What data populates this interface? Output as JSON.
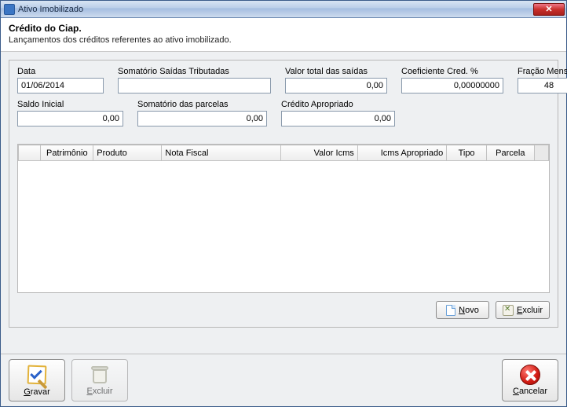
{
  "window": {
    "title": "Ativo Imobilizado"
  },
  "header": {
    "title": "Crédito do Ciap.",
    "subtitle": "Lançamentos dos créditos referentes ao ativo imobilizado."
  },
  "fields": {
    "data": {
      "label": "Data",
      "value": "01/06/2014"
    },
    "somatorio_saidas_trib": {
      "label": "Somatório Saídas Tributadas",
      "value": ""
    },
    "valor_total_saidas": {
      "label": "Valor total das saídas",
      "value": "0,00"
    },
    "coef_cred": {
      "label": "Coeficiente Cred. %",
      "value": "0,00000000"
    },
    "fracao_mensal": {
      "label": "Fração Mensal",
      "value": "48"
    },
    "saldo_inicial": {
      "label": "Saldo Inicial",
      "value": "0,00"
    },
    "somatorio_parcelas": {
      "label": "Somatório das parcelas",
      "value": "0,00"
    },
    "credito_apropriado": {
      "label": "Crédito Apropriado",
      "value": "0,00"
    }
  },
  "table": {
    "columns": {
      "patrimonio": "Patrimônio",
      "produto": "Produto",
      "nota_fiscal": "Nota Fiscal",
      "valor_icms": "Valor Icms",
      "icms_apropriado": "Icms Apropriado",
      "tipo": "Tipo",
      "parcela": "Parcela"
    },
    "rows": []
  },
  "inner_buttons": {
    "novo": "Novo",
    "excluir": "Excluir"
  },
  "bottom_buttons": {
    "gravar": "Gravar",
    "excluir": "Excluir",
    "cancelar": "Cancelar"
  }
}
